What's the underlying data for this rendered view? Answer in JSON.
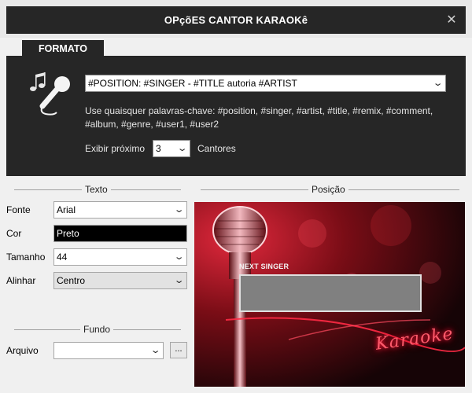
{
  "window": {
    "title": "OPçõES CANTOR KARAOKê",
    "close_icon": "close-icon"
  },
  "format": {
    "tab_label": "FORMATO",
    "pattern_value": "#POSITION: #SINGER - #TITLE autoria #ARTIST",
    "hint": "Use quaisquer palavras-chave: #position, #singer, #artist, #title, #remix, #comment, #album, #genre, #user1, #user2",
    "show_next_label": "Exibir próximo",
    "show_next_value": "3",
    "singers_label": "Cantores",
    "icon": "karaoke-microphone-icon"
  },
  "text_section": {
    "title": "Texto",
    "font_label": "Fonte",
    "font_value": "Arial",
    "color_label": "Cor",
    "color_value": "Preto",
    "size_label": "Tamanho",
    "size_value": "44",
    "align_label": "Alinhar",
    "align_value": "Centro"
  },
  "background_section": {
    "title": "Fundo",
    "file_label": "Arquivo",
    "file_value": "",
    "browse_label": "..."
  },
  "position_section": {
    "title": "Posição",
    "preview": {
      "next_singer_label": "NEXT SINGER",
      "neon_text": "Karaoke"
    }
  },
  "colors": {
    "dark_panel": "#262626",
    "window_bg": "#f0f0f0",
    "preview_red": "#c8102e"
  }
}
